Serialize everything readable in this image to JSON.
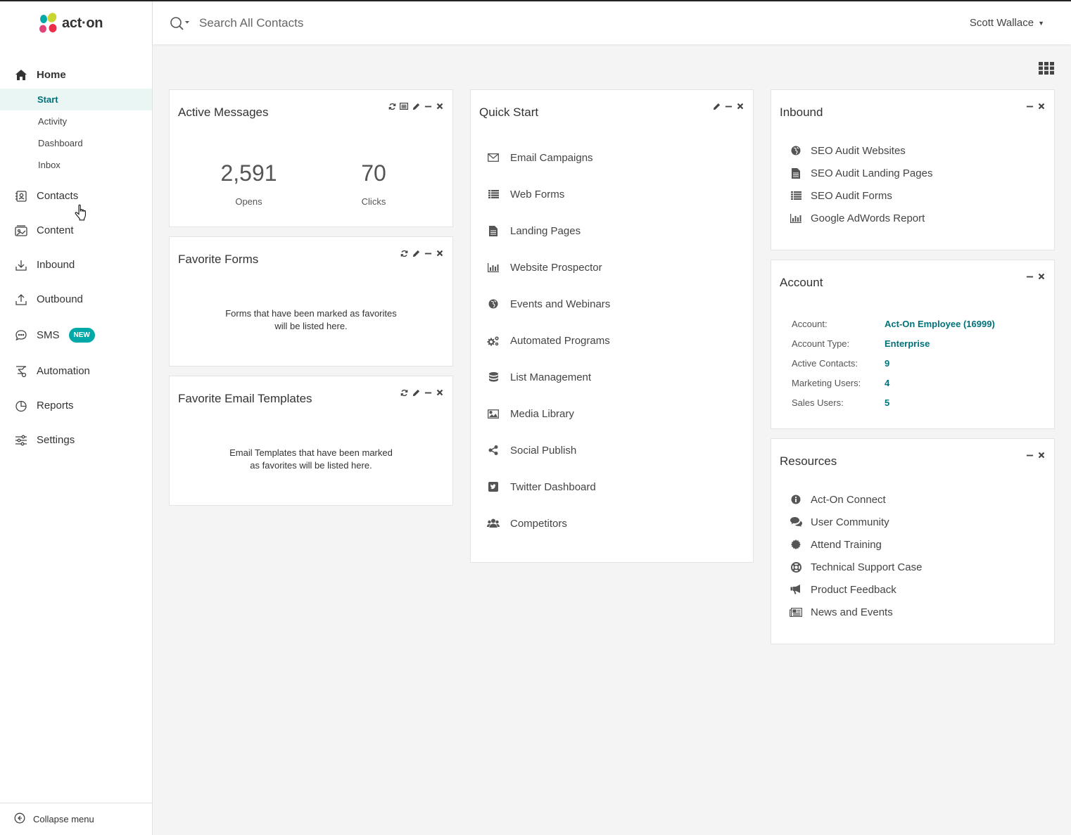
{
  "brand": {
    "name": "act·on"
  },
  "sidebar": {
    "home": "Home",
    "home_subitems": [
      {
        "label": "Start",
        "active": true
      },
      {
        "label": "Activity"
      },
      {
        "label": "Dashboard"
      },
      {
        "label": "Inbox"
      }
    ],
    "items": [
      {
        "label": "Contacts",
        "icon": "contacts-icon"
      },
      {
        "label": "Content",
        "icon": "content-icon"
      },
      {
        "label": "Inbound",
        "icon": "inbound-icon"
      },
      {
        "label": "Outbound",
        "icon": "outbound-icon"
      },
      {
        "label": "SMS",
        "icon": "sms-icon",
        "badge": "NEW"
      },
      {
        "label": "Automation",
        "icon": "automation-icon"
      },
      {
        "label": "Reports",
        "icon": "reports-icon"
      },
      {
        "label": "Settings",
        "icon": "settings-icon"
      }
    ],
    "collapse_label": "Collapse menu"
  },
  "header": {
    "search_placeholder": "Search All Contacts",
    "user_name": "Scott Wallace"
  },
  "active_messages": {
    "title": "Active Messages",
    "opens_value": "2,591",
    "opens_label": "Opens",
    "clicks_value": "70",
    "clicks_label": "Clicks"
  },
  "favorite_forms": {
    "title": "Favorite Forms",
    "empty_line1": "Forms that have been marked as favorites",
    "empty_line2": "will be listed here."
  },
  "favorite_templates": {
    "title": "Favorite Email Templates",
    "empty_line1": "Email Templates that have been marked",
    "empty_line2": "as favorites will be listed here."
  },
  "quick_start": {
    "title": "Quick Start",
    "items": [
      {
        "label": "Email Campaigns",
        "icon": "envelope-icon"
      },
      {
        "label": "Web Forms",
        "icon": "list-icon"
      },
      {
        "label": "Landing Pages",
        "icon": "file-icon"
      },
      {
        "label": "Website Prospector",
        "icon": "bar-chart-icon"
      },
      {
        "label": "Events and Webinars",
        "icon": "globe-icon"
      },
      {
        "label": "Automated Programs",
        "icon": "gears-icon"
      },
      {
        "label": "List Management",
        "icon": "database-icon"
      },
      {
        "label": "Media Library",
        "icon": "image-icon"
      },
      {
        "label": "Social Publish",
        "icon": "share-icon"
      },
      {
        "label": "Twitter Dashboard",
        "icon": "twitter-icon"
      },
      {
        "label": "Competitors",
        "icon": "users-icon"
      }
    ]
  },
  "inbound": {
    "title": "Inbound",
    "items": [
      {
        "label": "SEO Audit Websites",
        "icon": "globe-icon"
      },
      {
        "label": "SEO Audit Landing Pages",
        "icon": "file-icon"
      },
      {
        "label": "SEO Audit Forms",
        "icon": "list-icon"
      },
      {
        "label": "Google AdWords Report",
        "icon": "bar-chart-icon"
      }
    ]
  },
  "account": {
    "title": "Account",
    "rows": [
      {
        "key": "Account:",
        "value": "Act-On Employee (16999)"
      },
      {
        "key": "Account Type:",
        "value": "Enterprise"
      },
      {
        "key": "Active Contacts:",
        "value": "9"
      },
      {
        "key": "Marketing Users:",
        "value": "4"
      },
      {
        "key": "Sales Users:",
        "value": "5"
      }
    ]
  },
  "resources": {
    "title": "Resources",
    "items": [
      {
        "label": "Act-On Connect",
        "icon": "info-icon"
      },
      {
        "label": "User Community",
        "icon": "comments-icon"
      },
      {
        "label": "Attend Training",
        "icon": "certificate-icon"
      },
      {
        "label": "Technical Support Case",
        "icon": "lifebuoy-icon"
      },
      {
        "label": "Product Feedback",
        "icon": "bullhorn-icon"
      },
      {
        "label": "News and Events",
        "icon": "newspaper-icon"
      }
    ]
  },
  "colors": {
    "accent": "#00727a",
    "badge": "#00a9a7",
    "active_bg": "#eaf6f4"
  }
}
